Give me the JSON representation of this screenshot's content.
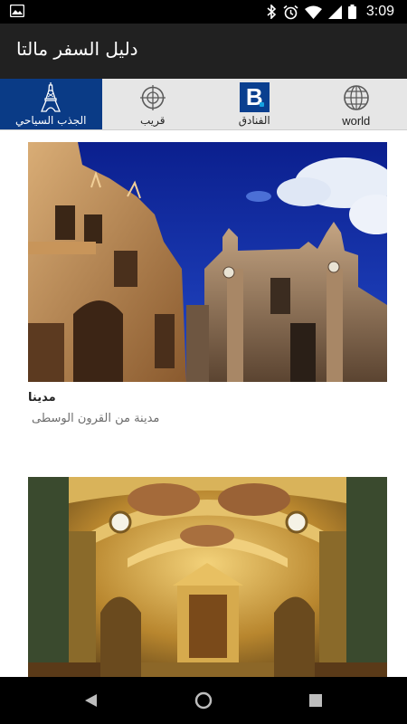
{
  "status_bar": {
    "time": "3:09",
    "icons": [
      "image-icon",
      "bluetooth-icon",
      "alarm-icon",
      "wifi-icon",
      "signal-icon",
      "battery-icon"
    ]
  },
  "app_bar": {
    "title": "دليل السفر مالتا",
    "background": "#212121"
  },
  "tabs": [
    {
      "label": "الجذب السياحي",
      "icon": "eiffel-tower-icon",
      "active": true
    },
    {
      "label": "قريب",
      "icon": "crosshair-icon",
      "active": false
    },
    {
      "label": "الفنادق",
      "icon": "booking-icon",
      "active": false
    },
    {
      "label": "world",
      "icon": "globe-icon",
      "active": false
    }
  ],
  "accent_color": "#0a3b86",
  "cards": [
    {
      "title": "مدينا",
      "subtitle": "مدينة من القرون الوسطى",
      "image": "mdina-cathedral-photo"
    },
    {
      "title": "",
      "subtitle": "",
      "image": "co-cathedral-interior-photo"
    }
  ],
  "nav_bar": {
    "buttons": [
      "back-icon",
      "home-icon",
      "recents-icon"
    ]
  }
}
